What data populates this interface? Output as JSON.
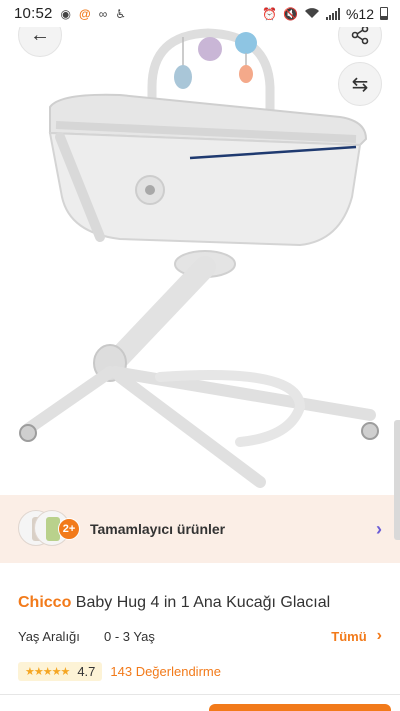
{
  "status_bar": {
    "time": "10:52",
    "battery_percent": "%12",
    "icons": [
      "media-circle-icon",
      "at-sign-icon",
      "voicemail-icon",
      "accessibility-icon",
      "alarm-icon",
      "mute-icon",
      "wifi-icon",
      "signal-icon",
      "battery-icon"
    ]
  },
  "image_actions": {
    "back_icon": "←",
    "share_icon": "⇪",
    "compare_icon": "⇆"
  },
  "product_image": {
    "subject": "baby bassinet with toy arch",
    "colors": {
      "frame": "#e8e8e8",
      "fabric": "#dcdcdc",
      "trim": "#1f3a70"
    }
  },
  "complementary": {
    "badge": "2+",
    "label": "Tamamlayıcı ürünler",
    "chevron": "›"
  },
  "product": {
    "brand": "Chicco",
    "title": "Baby Hug 4 in 1 Ana Kucağı Glacıal",
    "attribute_label": "Yaş Aralığı",
    "attribute_value": "0 - 3 Yaş",
    "all_link": "Tümü",
    "all_chevron": "›",
    "stars": "★★★★★",
    "rating": "4.7",
    "review_count_text": "143 Değerlendirme"
  },
  "colors": {
    "accent": "#f27a1a",
    "banner_bg": "#fbeee6",
    "chevron": "#6a5bd6",
    "star": "#f5a623"
  }
}
